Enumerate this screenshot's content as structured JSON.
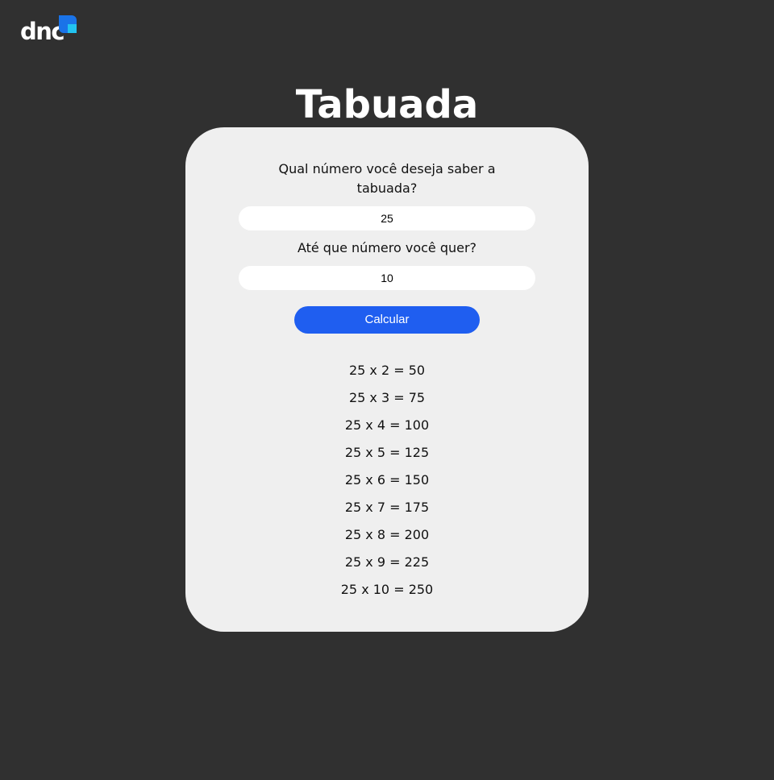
{
  "brand": {
    "logo_text": "dnc",
    "colors": {
      "dark_blue": "#1a73e8",
      "light_blue": "#22c3f0"
    }
  },
  "page": {
    "title": "Tabuada",
    "background": "#303030",
    "card_background": "#efefef"
  },
  "form": {
    "number_label": "Qual número você deseja saber a tabuada?",
    "number_value": "25",
    "limit_label": "Até que número você quer?",
    "limit_value": "10",
    "submit_label": "Calcular",
    "accent": "#1f5ef0"
  },
  "results": [
    "25 x 2 = 50",
    "25 x 3 = 75",
    "25 x 4 = 100",
    "25 x 5 = 125",
    "25 x 6 = 150",
    "25 x 7 = 175",
    "25 x 8 = 200",
    "25 x 9 = 225",
    "25 x 10 = 250"
  ]
}
